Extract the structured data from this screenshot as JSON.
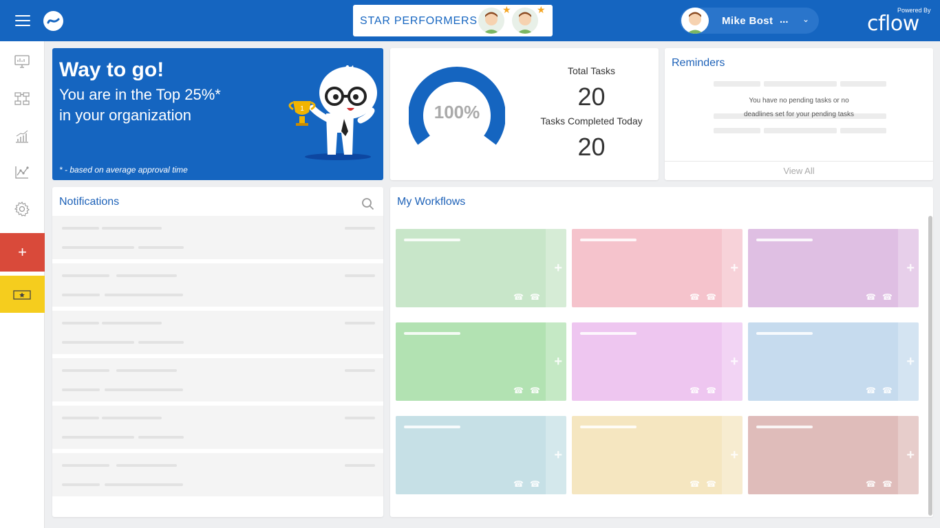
{
  "header": {
    "star_performers_label": "STAR PERFORMERS",
    "user_name": "Mike Bost",
    "user_more": "...",
    "powered_by": "Powered By",
    "brand": "cflow",
    "color": "#1565c0"
  },
  "sidebar": {
    "items": [
      "dashboard-icon",
      "workflow-icon",
      "reports-icon",
      "analytics-icon",
      "settings-icon"
    ],
    "add_label": "+",
    "add_color": "#d94a3a",
    "star_color": "#f5cd1e"
  },
  "promo": {
    "headline": "Way to go!",
    "line2": "You are in the Top  25%*",
    "line3": "in your organization",
    "note": "* - based on average approval time"
  },
  "stats": {
    "gauge_value": "100%",
    "gauge_fraction": 1.0,
    "total_tasks_label": "Total Tasks",
    "total_tasks": "20",
    "completed_label": "Tasks Completed Today",
    "completed": "20"
  },
  "reminders": {
    "title": "Reminders",
    "empty_line1": "You have no pending tasks or no",
    "empty_line2": "deadlines set for your pending tasks",
    "view_all": "View All"
  },
  "notifications": {
    "title": "Notifications"
  },
  "workflows": {
    "title": "My Workflows",
    "tile_colors": [
      "#c8e6c9",
      "#f5c3cc",
      "#dfbfe3",
      "#b2e2b2",
      "#eec6f0",
      "#c6dbee",
      "#c6e0e6",
      "#f5e6c0",
      "#dfbcba"
    ]
  }
}
